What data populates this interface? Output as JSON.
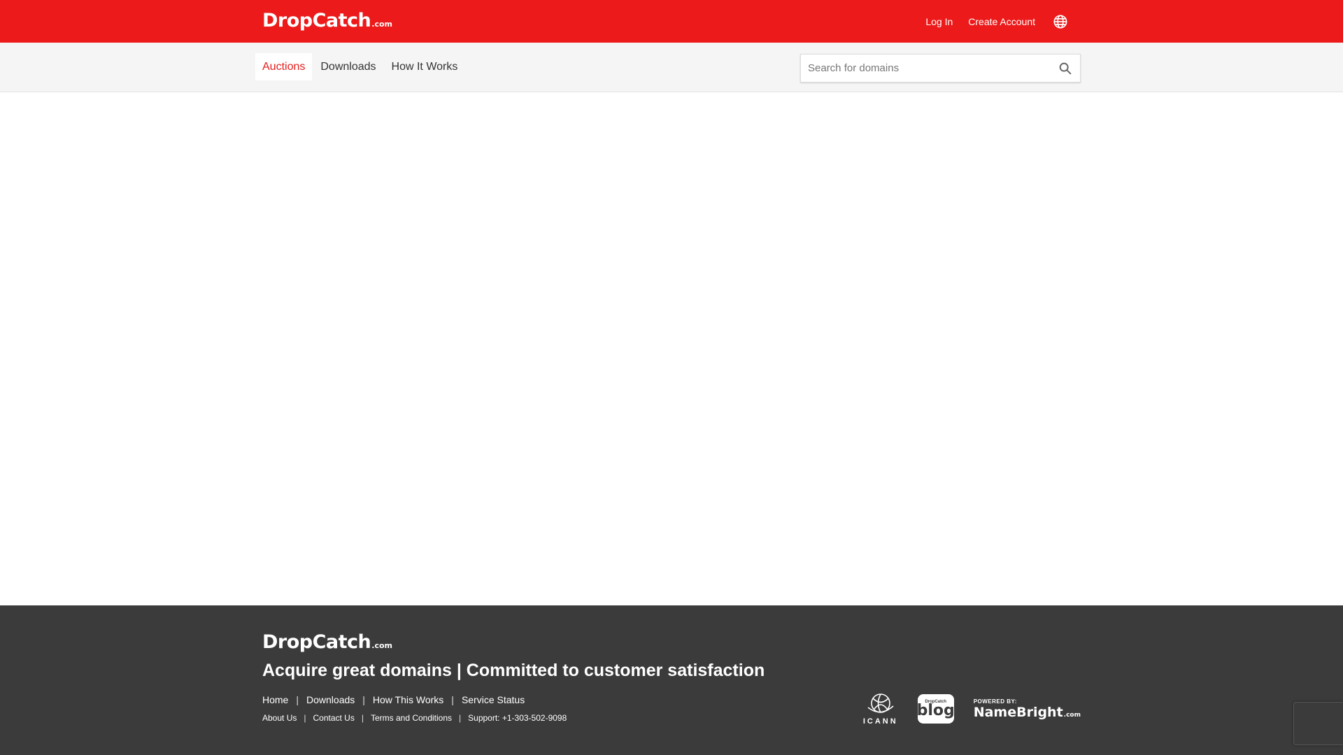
{
  "header": {
    "logo": {
      "brand": "DropCatch",
      "tld": ".com"
    },
    "login_label": "Log In",
    "create_account_label": "Create Account",
    "language_icon": "globe-icon"
  },
  "subnav": {
    "tabs": [
      {
        "label": "Auctions",
        "active": true
      },
      {
        "label": "Downloads",
        "active": false
      },
      {
        "label": "How It Works",
        "active": false
      }
    ],
    "search": {
      "placeholder": "Search for domains",
      "value": "",
      "icon": "search-icon"
    }
  },
  "footer": {
    "logo": {
      "brand": "DropCatch",
      "tld": ".com"
    },
    "tagline": "Acquire great domains | Committed to customer satisfaction",
    "primary_links": [
      "Home",
      "Downloads",
      "How This Works",
      "Service Status"
    ],
    "secondary_links": [
      "About Us",
      "Contact Us",
      "Terms and Conditions",
      "Support: +1-303-502-9098"
    ],
    "separator": "|",
    "badges": {
      "icann": "ICANN",
      "blog_small": "DropCatch",
      "blog_big": "blog",
      "powered_by": "POWERED BY:",
      "namebright": "NameBright",
      "namebright_tld": ".com"
    }
  },
  "colors": {
    "brand_red": "#ec1a1a",
    "active_tab_text": "#e61e1e",
    "footer_bg": "#3b3b3b",
    "subnav_bg": "#f5f5f5"
  }
}
